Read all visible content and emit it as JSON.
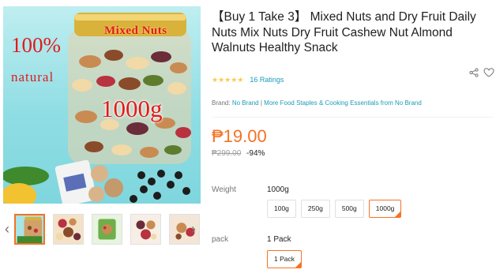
{
  "gallery": {
    "main_image": {
      "promo_percent": "100%",
      "promo_word": "natural",
      "jar_label": "Mixed Nuts",
      "weight_text": "1000g"
    },
    "thumbnails": [
      "mixed-nuts-jar",
      "nut-mix-bowl",
      "nut-mix-package",
      "dried-fruit-mix",
      "nuts-closeup"
    ],
    "active_thumbnail": 0
  },
  "product": {
    "title": "【Buy 1 Take 3】 Mixed Nuts and Dry Fruit Daily Nuts Mix Nuts Dry Fruit Cashew Nut Almond Walnuts Healthy Snack",
    "stars_filled": 5,
    "ratings_text": "16 Ratings",
    "brand_label": "Brand:",
    "brand_name": "No Brand",
    "brand_separator": "|",
    "more_link": "More Food Staples & Cooking Essentials from No Brand",
    "price": "₱19.00",
    "original_price": "₱299.00",
    "discount": "-94%"
  },
  "variants": {
    "weight": {
      "label": "Weight",
      "selected": "1000g",
      "options": [
        "100g",
        "250g",
        "500g",
        "1000g"
      ]
    },
    "pack": {
      "label": "pack",
      "selected": "1 Pack",
      "options": [
        "1 Pack"
      ]
    }
  },
  "colors": {
    "accent": "#f57224",
    "link": "#1a9cb7",
    "star": "#faca51"
  }
}
